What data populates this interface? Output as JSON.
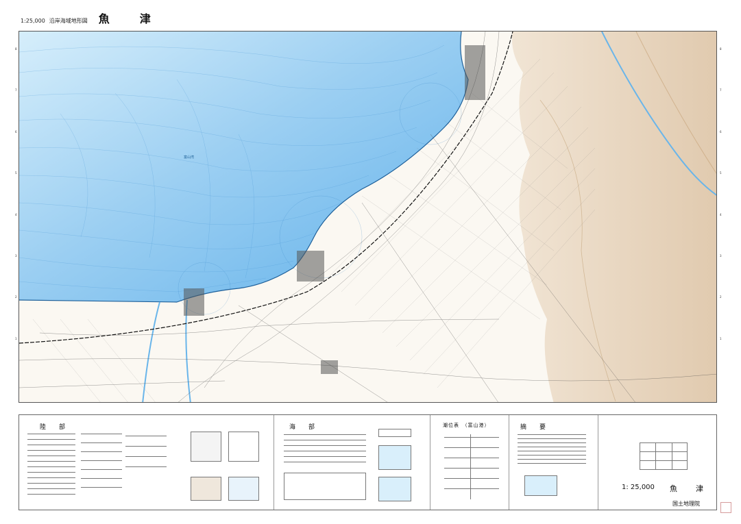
{
  "header": {
    "scale": "1:25,000",
    "subtitle": "沿岸海域地形図",
    "sheet_name": "魚　津"
  },
  "map": {
    "sea_label": "富山湾",
    "colors": {
      "sea_deep": "#69b5ea",
      "sea_shallow": "#d9effb",
      "land": "#fbf8f2",
      "terrain": "#e3cbaf",
      "roads": "#3c3c3c",
      "contours": "#7ab6e2"
    },
    "edge_labels_left": [
      "8",
      "7",
      "6",
      "5",
      "4",
      "3",
      "2",
      "1"
    ],
    "edge_labels_right": [
      "8",
      "7",
      "6",
      "5",
      "4",
      "3",
      "2",
      "1"
    ]
  },
  "legend": {
    "land_title": "陸　部",
    "sea_title": "海　部",
    "tide_title": "潮位表　（富山港）",
    "summary_title": "摘　要",
    "sheet_scale": "1: 25,000",
    "sheet_name": "魚　津",
    "publisher": "国土地理院"
  }
}
